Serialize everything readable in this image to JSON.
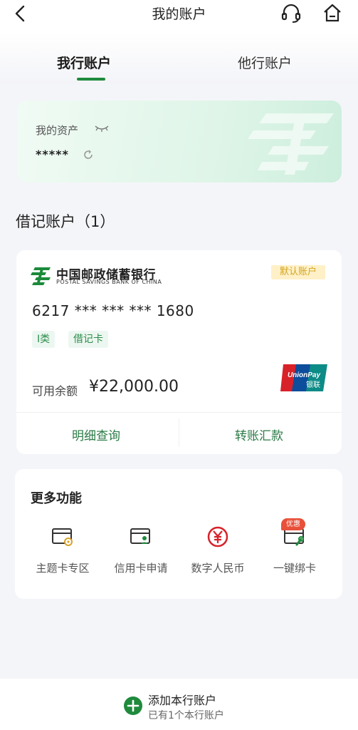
{
  "header": {
    "title": "我的账户",
    "back_icon": "chevron-left-icon",
    "service_icon": "headset-icon",
    "home_icon": "home-icon"
  },
  "tabs": [
    {
      "label": "我行账户",
      "active": true
    },
    {
      "label": "他行账户",
      "active": false
    }
  ],
  "assets": {
    "label": "我的资产",
    "masked_value": "*****",
    "eye_icon": "eye-closed-icon",
    "refresh_icon": "refresh-icon"
  },
  "debit_section": {
    "title": "借记账户（1）"
  },
  "account": {
    "bank_name_cn": "中国邮政储蓄银行",
    "bank_name_en": "POSTAL SAVINGS BANK OF CHINA",
    "default_badge": "默认账户",
    "card_number": "6217 *** *** *** 1680",
    "tags": [
      "I类",
      "借记卡"
    ],
    "balance_label": "可用余额",
    "balance": "¥22,000.00",
    "card_network": "UnionPay",
    "card_network_cn": "银联",
    "actions": [
      "明细查询",
      "转账汇款"
    ]
  },
  "more": {
    "title": "更多功能",
    "features": [
      {
        "label": "主题卡专区",
        "icon": "theme-card-icon"
      },
      {
        "label": "信用卡申请",
        "icon": "credit-card-apply-icon"
      },
      {
        "label": "数字人民币",
        "icon": "digital-rmb-icon"
      },
      {
        "label": "一键绑卡",
        "icon": "bind-card-icon"
      }
    ],
    "promo_badge": "优惠"
  },
  "bottom": {
    "add_title": "添加本行账户",
    "add_sub": "已有1个本行账户",
    "add_icon": "plus-circle-icon"
  },
  "colors": {
    "brand_green": "#1f8a3c",
    "badge_yellow": "#fff0c7",
    "promo_red": "#e8503a"
  }
}
